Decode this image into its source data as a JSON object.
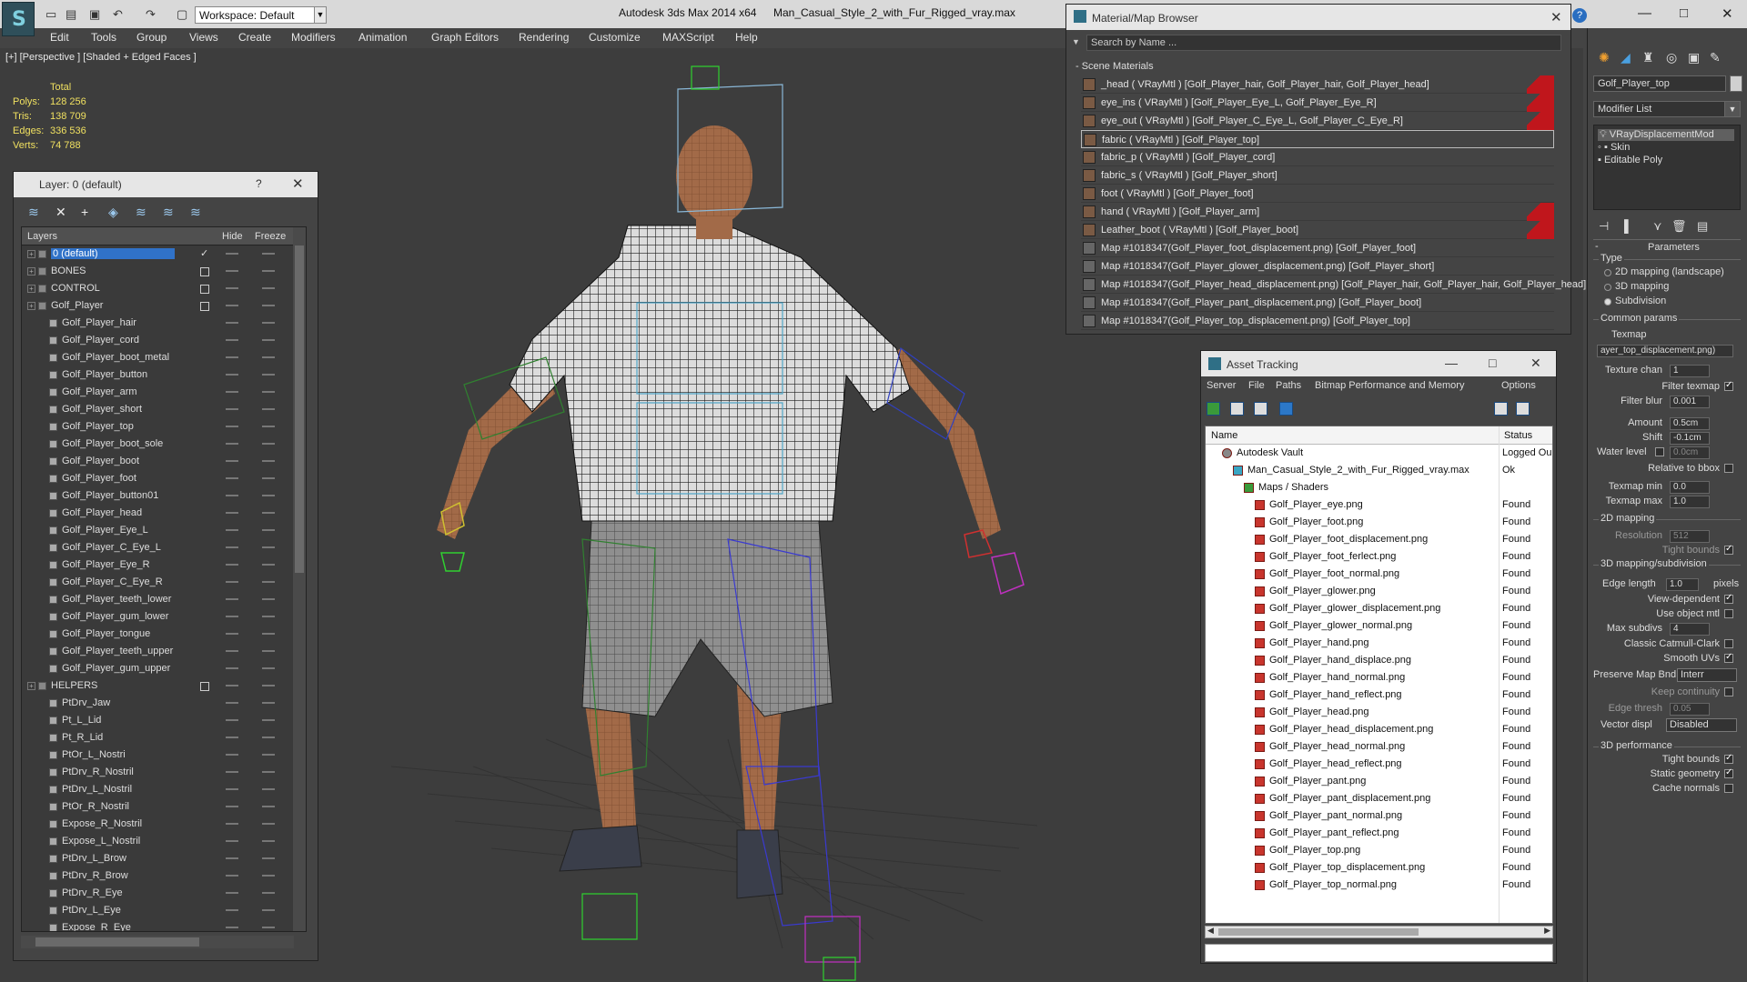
{
  "title_bar": {
    "workspace": "Workspace: Default",
    "app_title": "Autodesk 3ds Max  2014 x64",
    "file_title": "Man_Casual_Style_2_with_Fur_Rigged_vray.max",
    "help": "?",
    "minimize": "—",
    "maximize": "□",
    "close": "✕"
  },
  "menu": [
    "Edit",
    "Tools",
    "Group",
    "Views",
    "Create",
    "Modifiers",
    "Animation",
    "Graph Editors",
    "Rendering",
    "Customize",
    "MAXScript",
    "Help"
  ],
  "viewport": {
    "label": "[+] [Perspective ] [Shaded + Edged Faces ]",
    "stats_header": "Total",
    "stats": [
      {
        "label": "Polys:",
        "value": "128 256"
      },
      {
        "label": "Tris:",
        "value": "138 709"
      },
      {
        "label": "Edges:",
        "value": "336 536"
      },
      {
        "label": "Verts:",
        "value": "74 788"
      }
    ]
  },
  "layer_window": {
    "title": "Layer: 0 (default)",
    "help": "?",
    "close": "✕",
    "col_layers": "Layers",
    "col_hide": "Hide",
    "col_freeze": "Freeze",
    "rows": [
      {
        "name": "0 (default)",
        "level": 0
      },
      {
        "name": "BONES",
        "level": 0
      },
      {
        "name": "CONTROL",
        "level": 0
      },
      {
        "name": "Golf_Player",
        "level": 0
      },
      {
        "name": "Golf_Player_hair",
        "level": 1
      },
      {
        "name": "Golf_Player_cord",
        "level": 1
      },
      {
        "name": "Golf_Player_boot_metal",
        "level": 1
      },
      {
        "name": "Golf_Player_button",
        "level": 1
      },
      {
        "name": "Golf_Player_arm",
        "level": 1
      },
      {
        "name": "Golf_Player_short",
        "level": 1
      },
      {
        "name": "Golf_Player_top",
        "level": 1
      },
      {
        "name": "Golf_Player_boot_sole",
        "level": 1
      },
      {
        "name": "Golf_Player_boot",
        "level": 1
      },
      {
        "name": "Golf_Player_foot",
        "level": 1
      },
      {
        "name": "Golf_Player_button01",
        "level": 1
      },
      {
        "name": "Golf_Player_head",
        "level": 1
      },
      {
        "name": "Golf_Player_Eye_L",
        "level": 1
      },
      {
        "name": "Golf_Player_C_Eye_L",
        "level": 1
      },
      {
        "name": "Golf_Player_Eye_R",
        "level": 1
      },
      {
        "name": "Golf_Player_C_Eye_R",
        "level": 1
      },
      {
        "name": "Golf_Player_teeth_lower",
        "level": 1
      },
      {
        "name": "Golf_Player_gum_lower",
        "level": 1
      },
      {
        "name": "Golf_Player_tongue",
        "level": 1
      },
      {
        "name": "Golf_Player_teeth_upper",
        "level": 1
      },
      {
        "name": "Golf_Player_gum_upper",
        "level": 1
      },
      {
        "name": "HELPERS",
        "level": 0
      },
      {
        "name": "PtDrv_Jaw",
        "level": 1
      },
      {
        "name": "Pt_L_Lid",
        "level": 1
      },
      {
        "name": "Pt_R_Lid",
        "level": 1
      },
      {
        "name": "PtOr_L_Nostri",
        "level": 1
      },
      {
        "name": "PtDrv_R_Nostril",
        "level": 1
      },
      {
        "name": "PtDrv_L_Nostril",
        "level": 1
      },
      {
        "name": "PtOr_R_Nostril",
        "level": 1
      },
      {
        "name": "Expose_R_Nostril",
        "level": 1
      },
      {
        "name": "Expose_L_Nostril",
        "level": 1
      },
      {
        "name": "PtDrv_L_Brow",
        "level": 1
      },
      {
        "name": "PtDrv_R_Brow",
        "level": 1
      },
      {
        "name": "PtDrv_R_Eye",
        "level": 1
      },
      {
        "name": "PtDrv_L_Eye",
        "level": 1
      },
      {
        "name": "Expose_R_Eye",
        "level": 1
      }
    ]
  },
  "material_browser": {
    "title": "Material/Map Browser",
    "close": "✕",
    "search_placeholder": "Search by Name ...",
    "section": "- Scene Materials",
    "items": [
      {
        "text": "_head  ( VRayMtl ) [Golf_Player_hair, Golf_Player_hair, Golf_Player_head]",
        "kind": "mtl",
        "red": true
      },
      {
        "text": "eye_ins  ( VRayMtl ) [Golf_Player_Eye_L, Golf_Player_Eye_R]",
        "kind": "mtl",
        "red": true
      },
      {
        "text": "eye_out  ( VRayMtl ) [Golf_Player_C_Eye_L, Golf_Player_C_Eye_R]",
        "kind": "mtl",
        "red": true
      },
      {
        "text": "fabric  ( VRayMtl ) [Golf_Player_top]",
        "kind": "mtl",
        "red": false,
        "selected": true
      },
      {
        "text": "fabric_p  ( VRayMtl ) [Golf_Player_cord]",
        "kind": "mtl",
        "red": false
      },
      {
        "text": "fabric_s  ( VRayMtl ) [Golf_Player_short]",
        "kind": "mtl",
        "red": false
      },
      {
        "text": "foot  ( VRayMtl ) [Golf_Player_foot]",
        "kind": "mtl",
        "red": false
      },
      {
        "text": "hand  ( VRayMtl ) [Golf_Player_arm]",
        "kind": "mtl",
        "red": true
      },
      {
        "text": "Leather_boot  ( VRayMtl ) [Golf_Player_boot]",
        "kind": "mtl",
        "red": true
      },
      {
        "text": "Map #1018347(Golf_Player_foot_displacement.png) [Golf_Player_foot]",
        "kind": "map",
        "red": false
      },
      {
        "text": "Map #1018347(Golf_Player_glower_displacement.png) [Golf_Player_short]",
        "kind": "map",
        "red": false
      },
      {
        "text": "Map #1018347(Golf_Player_head_displacement.png) [Golf_Player_hair, Golf_Player_hair, Golf_Player_head]",
        "kind": "map",
        "red": false
      },
      {
        "text": "Map #1018347(Golf_Player_pant_displacement.png) [Golf_Player_boot]",
        "kind": "map",
        "red": false
      },
      {
        "text": "Map #1018347(Golf_Player_top_displacement.png) [Golf_Player_top]",
        "kind": "map",
        "red": false
      }
    ]
  },
  "asset_tracking": {
    "title": "Asset Tracking",
    "minimize": "—",
    "maximize": "□",
    "close": "✕",
    "menu": [
      "Server",
      "File",
      "Paths",
      "Bitmap Performance and Memory",
      "Options"
    ],
    "col_name": "Name",
    "col_status": "Status",
    "rows": [
      {
        "name": "Autodesk Vault",
        "status": "Logged Ou",
        "indent": 1,
        "icon": "vault"
      },
      {
        "name": "Man_Casual_Style_2_with_Fur_Rigged_vray.max",
        "status": "Ok",
        "indent": 2,
        "icon": "max"
      },
      {
        "name": "Maps / Shaders",
        "status": "",
        "indent": 3,
        "icon": "fold"
      },
      {
        "name": "Golf_Player_eye.png",
        "status": "Found",
        "indent": 4,
        "icon": "png"
      },
      {
        "name": "Golf_Player_foot.png",
        "status": "Found",
        "indent": 4,
        "icon": "png"
      },
      {
        "name": "Golf_Player_foot_displacement.png",
        "status": "Found",
        "indent": 4,
        "icon": "png"
      },
      {
        "name": "Golf_Player_foot_ferlect.png",
        "status": "Found",
        "indent": 4,
        "icon": "png"
      },
      {
        "name": "Golf_Player_foot_normal.png",
        "status": "Found",
        "indent": 4,
        "icon": "png"
      },
      {
        "name": "Golf_Player_glower.png",
        "status": "Found",
        "indent": 4,
        "icon": "png"
      },
      {
        "name": "Golf_Player_glower_displacement.png",
        "status": "Found",
        "indent": 4,
        "icon": "png"
      },
      {
        "name": "Golf_Player_glower_normal.png",
        "status": "Found",
        "indent": 4,
        "icon": "png"
      },
      {
        "name": "Golf_Player_hand.png",
        "status": "Found",
        "indent": 4,
        "icon": "png"
      },
      {
        "name": "Golf_Player_hand_displace.png",
        "status": "Found",
        "indent": 4,
        "icon": "png"
      },
      {
        "name": "Golf_Player_hand_normal.png",
        "status": "Found",
        "indent": 4,
        "icon": "png"
      },
      {
        "name": "Golf_Player_hand_reflect.png",
        "status": "Found",
        "indent": 4,
        "icon": "png"
      },
      {
        "name": "Golf_Player_head.png",
        "status": "Found",
        "indent": 4,
        "icon": "png"
      },
      {
        "name": "Golf_Player_head_displacement.png",
        "status": "Found",
        "indent": 4,
        "icon": "png"
      },
      {
        "name": "Golf_Player_head_normal.png",
        "status": "Found",
        "indent": 4,
        "icon": "png"
      },
      {
        "name": "Golf_Player_head_reflect.png",
        "status": "Found",
        "indent": 4,
        "icon": "png"
      },
      {
        "name": "Golf_Player_pant.png",
        "status": "Found",
        "indent": 4,
        "icon": "png"
      },
      {
        "name": "Golf_Player_pant_displacement.png",
        "status": "Found",
        "indent": 4,
        "icon": "png"
      },
      {
        "name": "Golf_Player_pant_normal.png",
        "status": "Found",
        "indent": 4,
        "icon": "png"
      },
      {
        "name": "Golf_Player_pant_reflect.png",
        "status": "Found",
        "indent": 4,
        "icon": "png"
      },
      {
        "name": "Golf_Player_top.png",
        "status": "Found",
        "indent": 4,
        "icon": "png"
      },
      {
        "name": "Golf_Player_top_displacement.png",
        "status": "Found",
        "indent": 4,
        "icon": "png"
      },
      {
        "name": "Golf_Player_top_normal.png",
        "status": "Found",
        "indent": 4,
        "icon": "png"
      }
    ]
  },
  "command_panel": {
    "object_name": "Golf_Player_top",
    "modifier_list": "Modifier List",
    "stack": [
      {
        "name": "VRayDisplacementMod",
        "selected": true
      },
      {
        "name": "Skin",
        "selected": false
      },
      {
        "name": "Editable Poly",
        "selected": false
      }
    ],
    "parameters_title": "Parameters",
    "type_group": "Type",
    "type_options": [
      {
        "label": "2D mapping (landscape)",
        "on": false
      },
      {
        "label": "3D mapping",
        "on": false
      },
      {
        "label": "Subdivision",
        "on": true
      }
    ],
    "common_group": "Common params",
    "texmap_label": "Texmap",
    "texmap_value": "ayer_top_displacement.png)",
    "texture_chan_label": "Texture chan",
    "texture_chan": "1",
    "filter_texmap": "Filter texmap",
    "filter_blur_label": "Filter blur",
    "filter_blur": "0.001",
    "amount_label": "Amount",
    "amount": "0.5cm",
    "shift_label": "Shift",
    "shift": "-0.1cm",
    "water_level_label": "Water level",
    "water_level": "0.0cm",
    "relative_bbox": "Relative to bbox",
    "texmap_min_label": "Texmap min",
    "texmap_min": "0.0",
    "texmap_max_label": "Texmap max",
    "texmap_max": "1.0",
    "mapping2d_group": "2D mapping",
    "resolution_label": "Resolution",
    "resolution": "512",
    "tight_bounds_2d": "Tight bounds",
    "mapping3d_group": "3D mapping/subdivision",
    "edge_length_label": "Edge length",
    "edge_length": "1.0",
    "pixels": "pixels",
    "view_dependent": "View-dependent",
    "use_object_mtl": "Use object mtl",
    "max_subdivs_label": "Max subdivs",
    "max_subdivs": "4",
    "classic_catmull": "Classic Catmull-Clark",
    "smooth_uvs": "Smooth UVs",
    "preserve_map_label": "Preserve Map Bnd",
    "preserve_map": "Interr",
    "keep_continuity": "Keep continuity",
    "edge_thresh_label": "Edge thresh",
    "edge_thresh": "0.05",
    "vector_displ_label": "Vector displ",
    "vector_displ": "Disabled",
    "perf_group": "3D performance",
    "tight_bounds_3d": "Tight bounds",
    "static_geometry": "Static geometry",
    "cache_normals": "Cache normals"
  }
}
